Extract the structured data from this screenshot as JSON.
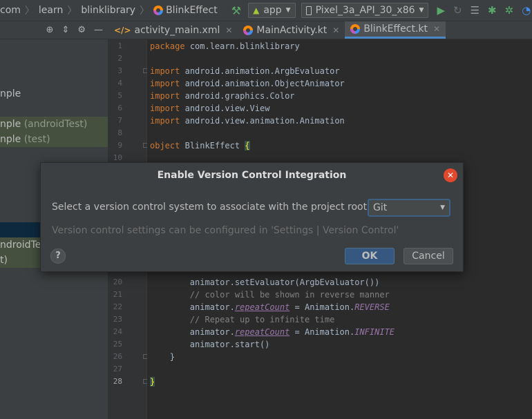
{
  "breadcrumbs": {
    "items": [
      "com",
      "learn",
      "blinklibrary",
      "BlinkEffect"
    ]
  },
  "toolbar": {
    "run_config": "app",
    "device": "Pixel_3a_API_30_x86",
    "icons": [
      "hammer-icon",
      "android-icon",
      "device-icon",
      "run-icon",
      "rerun-icon",
      "sync-icon",
      "debug-icon",
      "attach-debugger-icon",
      "profiler-icon"
    ]
  },
  "project_panel": {
    "toolbar_icons": [
      "crosshair-icon",
      "collapse-icon",
      "gear-icon",
      "minimize-icon"
    ],
    "items": [
      {
        "text": "nple",
        "suffix": "",
        "style": "normal"
      },
      {
        "text": "nple",
        "suffix": "(androidTest)",
        "style": "green"
      },
      {
        "text": "nple",
        "suffix": "(test)",
        "style": "green"
      },
      {
        "text": "",
        "suffix": "",
        "style": "selected"
      },
      {
        "text": "ndroidTes",
        "suffix": "",
        "style": "green"
      },
      {
        "text": "t)",
        "suffix": "",
        "style": "green"
      }
    ]
  },
  "tabs": [
    {
      "label": "activity_main.xml",
      "icon": "xml-file-icon",
      "active": false
    },
    {
      "label": "MainActivity.kt",
      "icon": "kotlin-file-icon",
      "active": false
    },
    {
      "label": "BlinkEffect.kt",
      "icon": "kotlin-file-icon",
      "active": true
    }
  ],
  "editor": {
    "current_line": "28",
    "lines": [
      {
        "n": "1",
        "html": "<span class=\"kw\">package</span> <span class=\"plain\">com.learn.blinklibrary</span>"
      },
      {
        "n": "2",
        "html": ""
      },
      {
        "n": "3",
        "html": "<span class=\"kw\">import</span> <span class=\"plain\">android.animation.ArgbEvaluator</span>"
      },
      {
        "n": "4",
        "html": "<span class=\"kw\">import</span> <span class=\"plain\">android.animation.ObjectAnimator</span>"
      },
      {
        "n": "5",
        "html": "<span class=\"kw\">import</span> <span class=\"plain\">android.graphics.Color</span>"
      },
      {
        "n": "6",
        "html": "<span class=\"kw\">import</span> <span class=\"plain\">android.view.View</span>"
      },
      {
        "n": "7",
        "html": "<span class=\"kw\">import</span> <span class=\"plain\">android.view.animation.Animation</span>"
      },
      {
        "n": "8",
        "html": ""
      },
      {
        "n": "9",
        "html": "<span class=\"kw\">object</span> <span class=\"plain\">BlinkEffect </span><span class=\"brace-hl\">{</span>"
      },
      {
        "n": "10",
        "html": ""
      },
      {
        "n": "20",
        "html": "        <span class=\"plain\">animator.setEvaluator(ArgbEvaluator())</span>"
      },
      {
        "n": "21",
        "html": "        <span class=\"cmt\">// color will be shown in reverse manner</span>"
      },
      {
        "n": "22",
        "html": "        <span class=\"plain\">animator.</span><span class=\"prop ital\">repeatCount</span><span class=\"plain\"> = Animation.</span><span class=\"ital\">REVERSE</span>"
      },
      {
        "n": "23",
        "html": "        <span class=\"cmt\">// Repeat up to infinite time</span>"
      },
      {
        "n": "24",
        "html": "        <span class=\"plain\">animator.</span><span class=\"prop ital\">repeatCount</span><span class=\"plain\"> = Animation.</span><span class=\"ital\">INFINITE</span>"
      },
      {
        "n": "25",
        "html": "        <span class=\"plain\">animator.start()</span>"
      },
      {
        "n": "26",
        "html": "    <span class=\"plain\">}</span>"
      },
      {
        "n": "27",
        "html": ""
      },
      {
        "n": "28",
        "html": "<span class=\"brace-hl\">}</span>"
      }
    ]
  },
  "dialog": {
    "title": "Enable Version Control Integration",
    "prompt": "Select a version control system to associate with the project root:",
    "selected_vcs": "Git",
    "hint": "Version control settings can be configured in 'Settings | Version Control'",
    "help_label": "?",
    "ok_label": "OK",
    "cancel_label": "Cancel",
    "close_label": "✕"
  },
  "colors": {
    "accent_blue": "#4a88c7",
    "close_red": "#e0492e",
    "run_green": "#59a869",
    "keyword_orange": "#cc7832"
  }
}
